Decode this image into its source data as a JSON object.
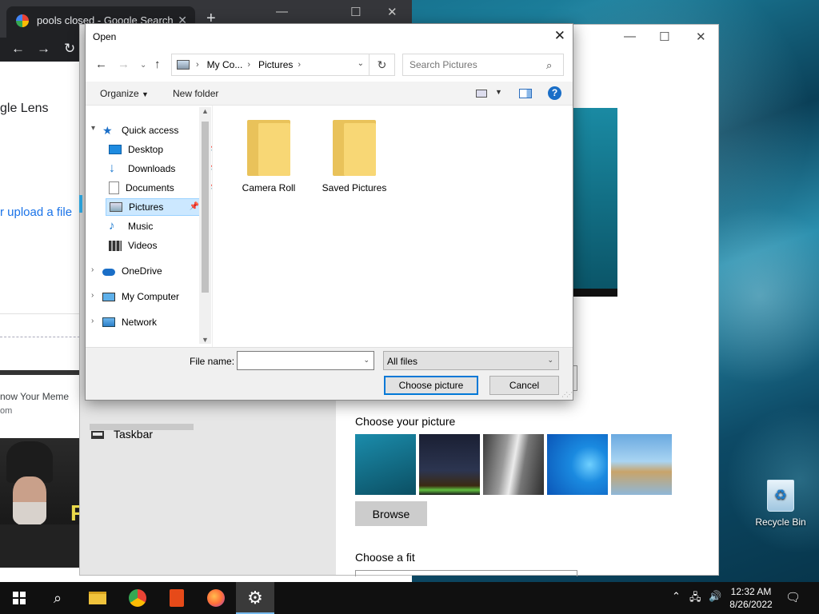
{
  "desktop": {
    "recycle_bin_label": "Recycle Bin"
  },
  "chrome": {
    "tab_title": "pools closed - Google Search",
    "lens_text": "gle Lens",
    "upload_text": "r upload a file",
    "result_title": "now Your Meme",
    "result_sub": "om"
  },
  "settings": {
    "nav_taskbar": "Taskbar",
    "choose_picture_heading": "Choose your picture",
    "browse_label": "Browse",
    "choose_fit_heading": "Choose a fit"
  },
  "dialog": {
    "title": "Open",
    "address": {
      "segments": [
        "My Co...",
        "Pictures"
      ]
    },
    "search_placeholder": "Search Pictures",
    "commands": {
      "organize": "Organize",
      "new_folder": "New folder"
    },
    "nav": {
      "quick_access": "Quick access",
      "items": [
        "Desktop",
        "Downloads",
        "Documents",
        "Pictures",
        "Music",
        "Videos"
      ],
      "onedrive": "OneDrive",
      "my_computer": "My Computer",
      "network": "Network"
    },
    "folders": [
      "Camera Roll",
      "Saved Pictures"
    ],
    "file_name_label": "File name:",
    "file_name_value": "",
    "filter_value": "All files",
    "buttons": {
      "choose": "Choose picture",
      "cancel": "Cancel"
    }
  },
  "taskbar": {
    "time": "12:32 AM",
    "date": "8/26/2022"
  },
  "colors": {
    "accent": "#0078d7",
    "selection": "#cce8ff",
    "folder": "#f8d775",
    "taskbar": "#101010"
  }
}
